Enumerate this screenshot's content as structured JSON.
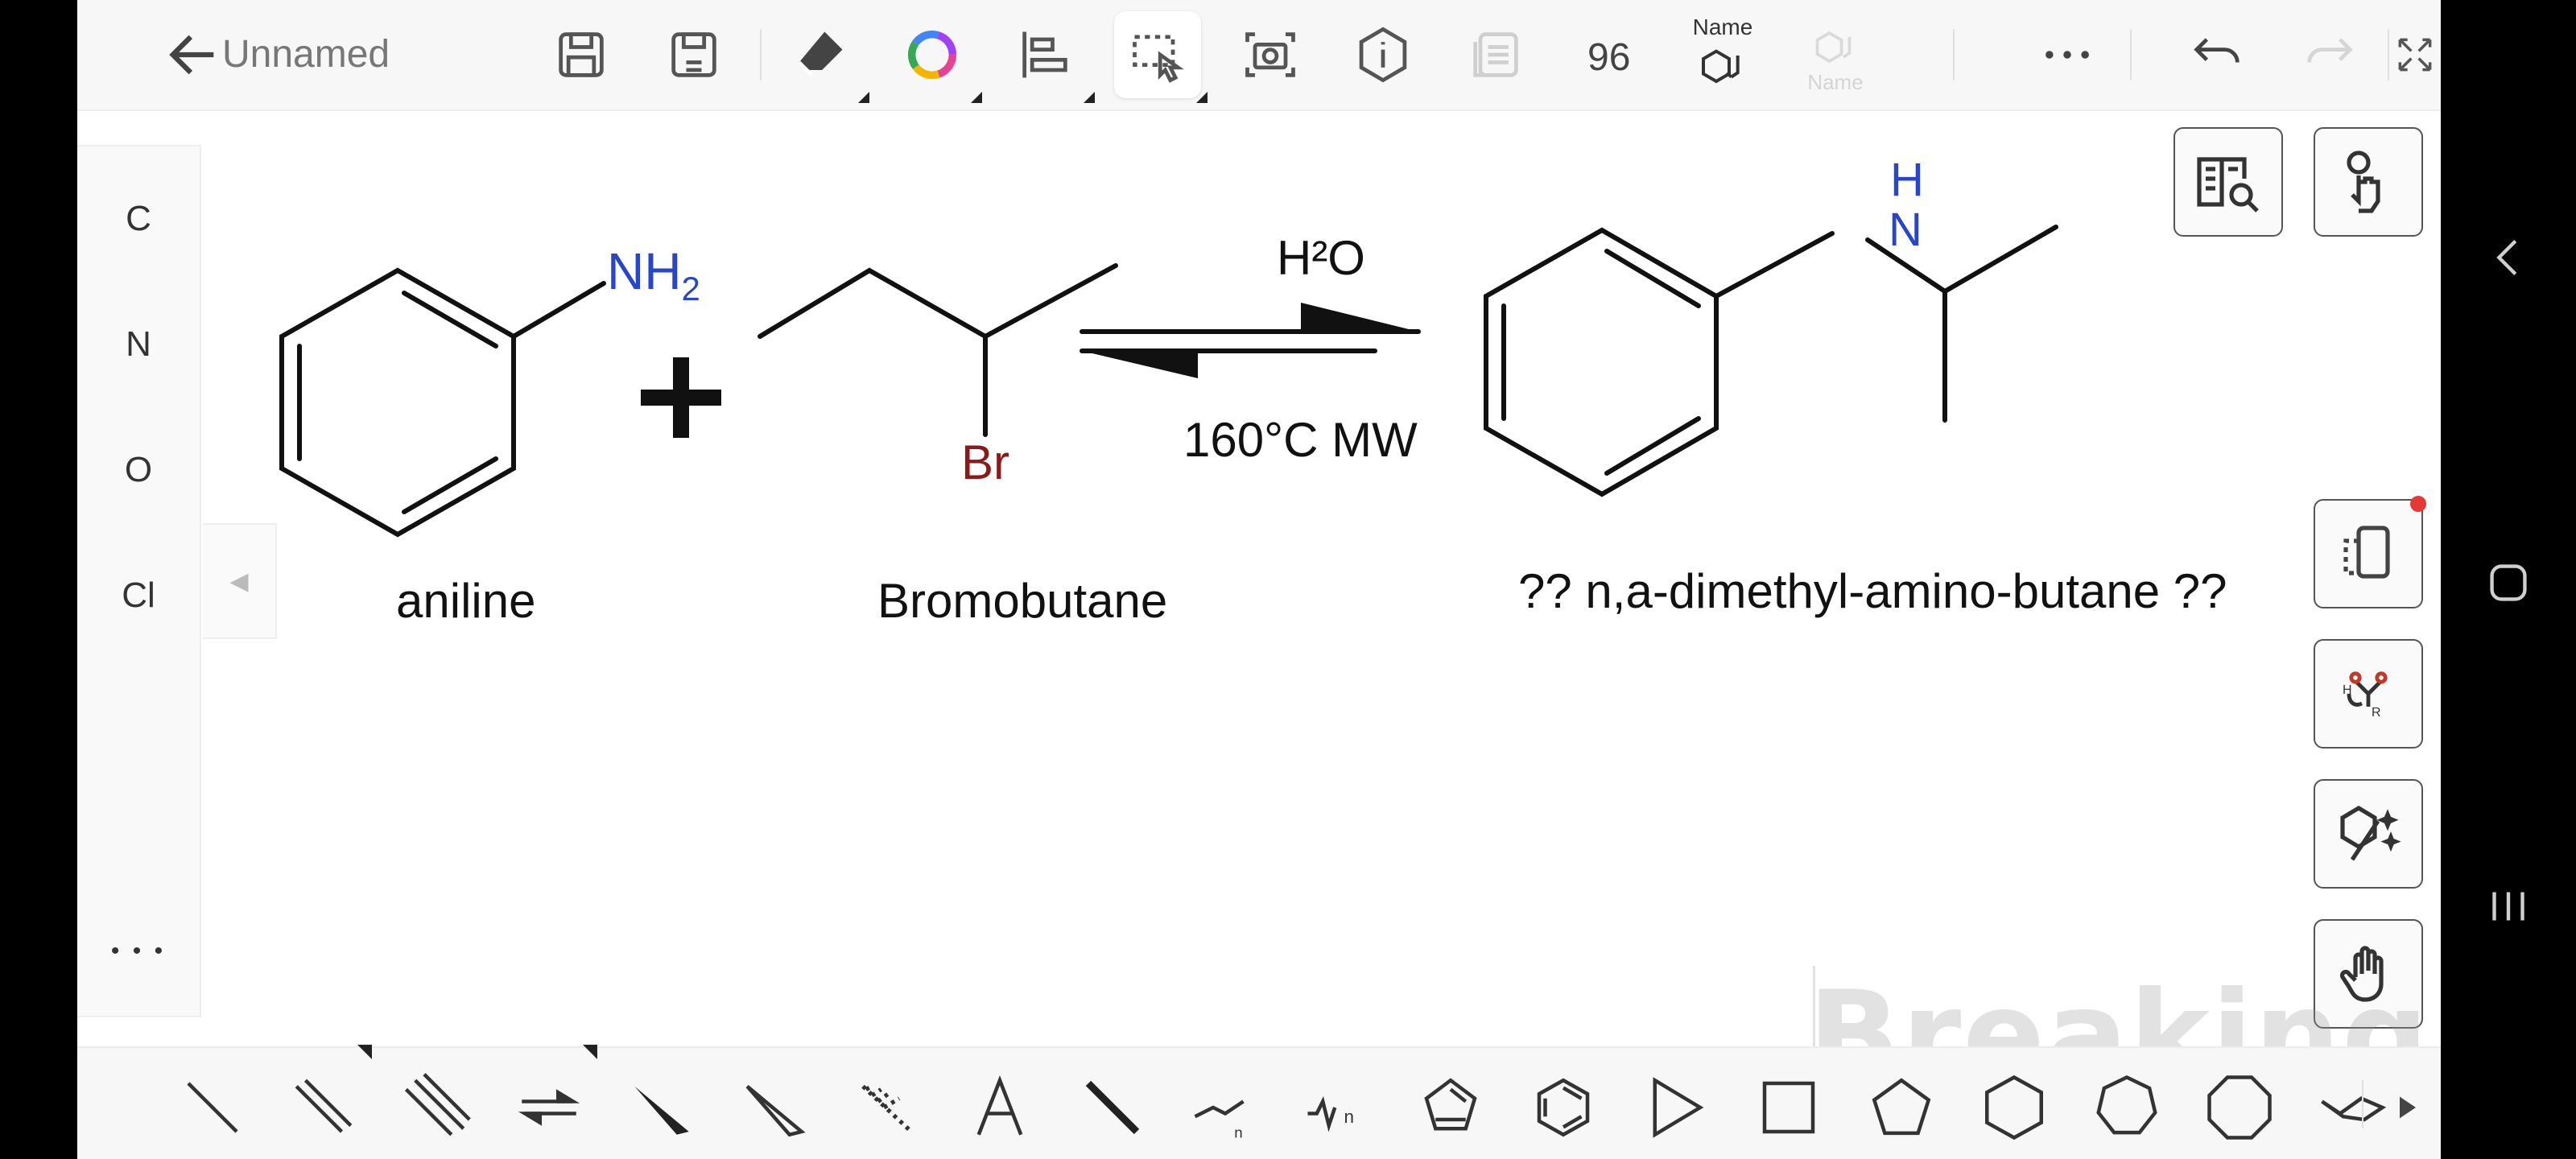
{
  "app": {
    "document_title": "Unnamed",
    "zoom_value": "96",
    "name_tool_label": "Name",
    "name_tool_disabled_label": "Name"
  },
  "elements": [
    "C",
    "N",
    "O",
    "Cl"
  ],
  "element_more": "• • •",
  "canvas": {
    "aniline_label": "aniline",
    "aniline_group": "NH",
    "aniline_group_sub": "2",
    "plus": "+",
    "bromobutane_label": "Bromobutane",
    "bromine_atom": "Br",
    "condition_top": "H²O",
    "condition_bottom": "160°C  MW",
    "product_label": "?? n,a-dimethyl-amino-butane ??",
    "product_n": "N",
    "product_h": "H"
  },
  "watermark": "BreakingBad",
  "colors": {
    "nitrogen": "#2a46c8",
    "bromine": "#8b1a1a",
    "toolbar_bg": "#f7f7f7",
    "canvas_bg": "#ffffff",
    "notification_dot": "#e53935"
  },
  "icons": {
    "top": [
      "back-arrow-icon",
      "save-icon",
      "save-as-icon",
      "eraser-icon",
      "color-wheel-icon",
      "align-icon",
      "lasso-select-icon",
      "screenshot-icon",
      "info-icon",
      "copy-icon",
      "name-structure-icon",
      "more-icon",
      "undo-icon",
      "redo-icon",
      "fullscreen-icon"
    ],
    "right": [
      "search-book-icon",
      "touch-gesture-icon",
      "device-icon",
      "reaction-mechanism-icon",
      "clean-structure-icon",
      "hand-pan-icon"
    ],
    "bottom": [
      "single-bond-icon",
      "double-bond-icon",
      "triple-bond-icon",
      "equilibrium-arrow-icon",
      "wedge-bond-icon",
      "hashed-wedge-icon",
      "dashed-bond-icon",
      "text-tool-icon",
      "bold-bond-icon",
      "chain-icon",
      "chain-n-icon",
      "cyclopentadiene-icon",
      "benzene-icon",
      "triangle-icon",
      "square-icon",
      "pentagon-icon",
      "hexagon-icon",
      "heptagon-icon",
      "octagon-icon",
      "chair-icon",
      "expand-arrow-icon"
    ]
  }
}
